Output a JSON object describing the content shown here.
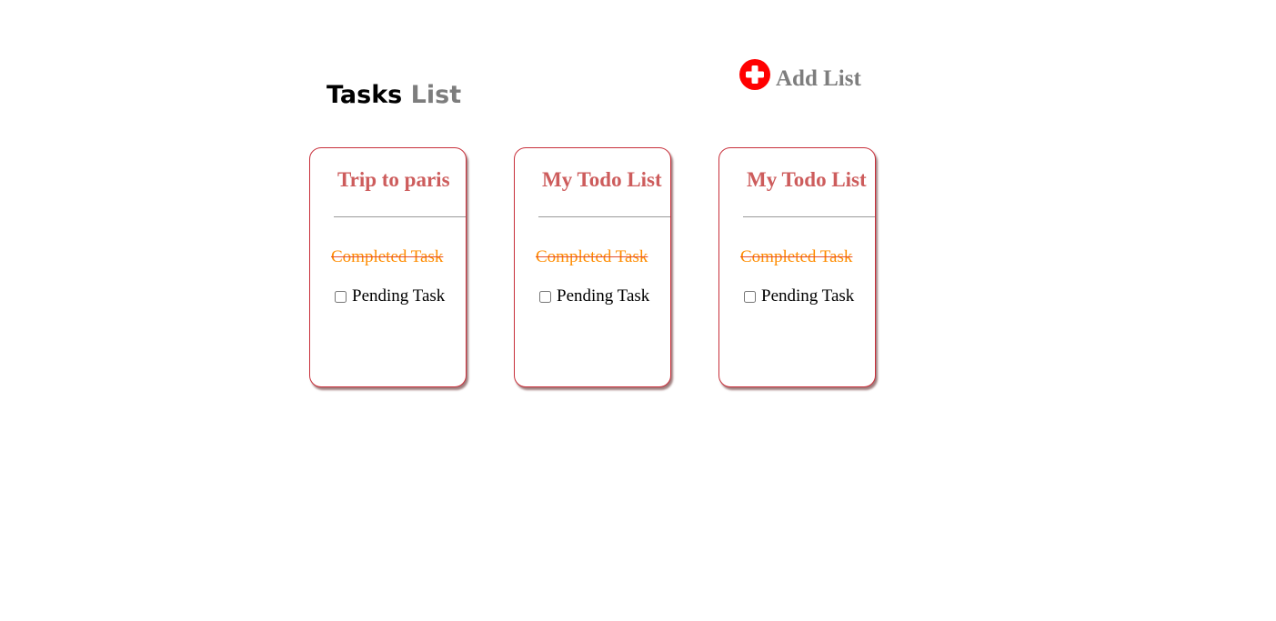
{
  "header": {
    "title_part1": "Tasks",
    "title_part2": "List",
    "add_list_label": "Add List",
    "add_icon": "plus-circle-icon",
    "accent_color": "#ff0000"
  },
  "lists": [
    {
      "title": "Trip to paris",
      "completed_task": "Completed Task",
      "pending_task": "Pending Task",
      "pending_checked": false
    },
    {
      "title": "My Todo List",
      "completed_task": "Completed Task",
      "pending_task": "Pending Task",
      "pending_checked": false
    },
    {
      "title": "My Todo List",
      "completed_task": "Completed Task",
      "pending_task": "Pending Task",
      "pending_checked": false
    }
  ],
  "colors": {
    "card_border": "#c8303b",
    "card_title": "#cd5c5c",
    "completed_text": "#ff8c00",
    "title_gray": "#7d7d7d"
  }
}
